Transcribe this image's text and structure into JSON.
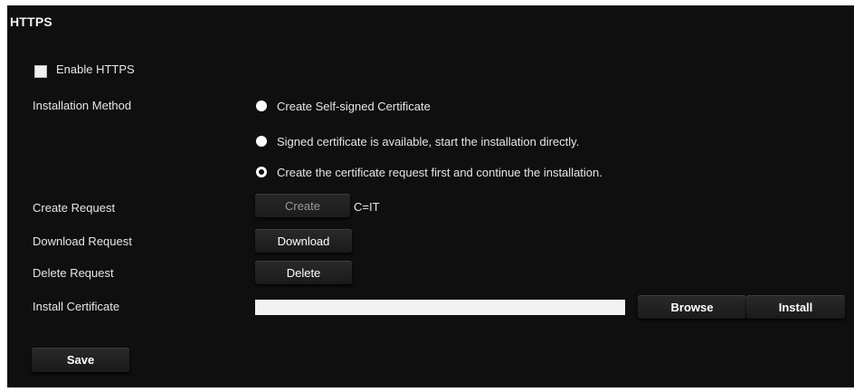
{
  "section": {
    "title": "HTTPS"
  },
  "enable_https": {
    "label": "Enable HTTPS",
    "checked": false
  },
  "installation_method": {
    "label": "Installation Method",
    "options": [
      {
        "label": "Create Self-signed Certificate",
        "selected": false
      },
      {
        "label": "Signed certificate is available, start the installation directly.",
        "selected": false
      },
      {
        "label": "Create the certificate request first and continue the installation.",
        "selected": true
      }
    ]
  },
  "create_request": {
    "label": "Create Request",
    "button": "Create",
    "value": "C=IT"
  },
  "download_request": {
    "label": "Download Request",
    "button": "Download"
  },
  "delete_request": {
    "label": "Delete Request",
    "button": "Delete"
  },
  "install_certificate": {
    "label": "Install Certificate",
    "file_value": "",
    "browse_button": "Browse",
    "install_button": "Install"
  },
  "save_button": "Save"
}
